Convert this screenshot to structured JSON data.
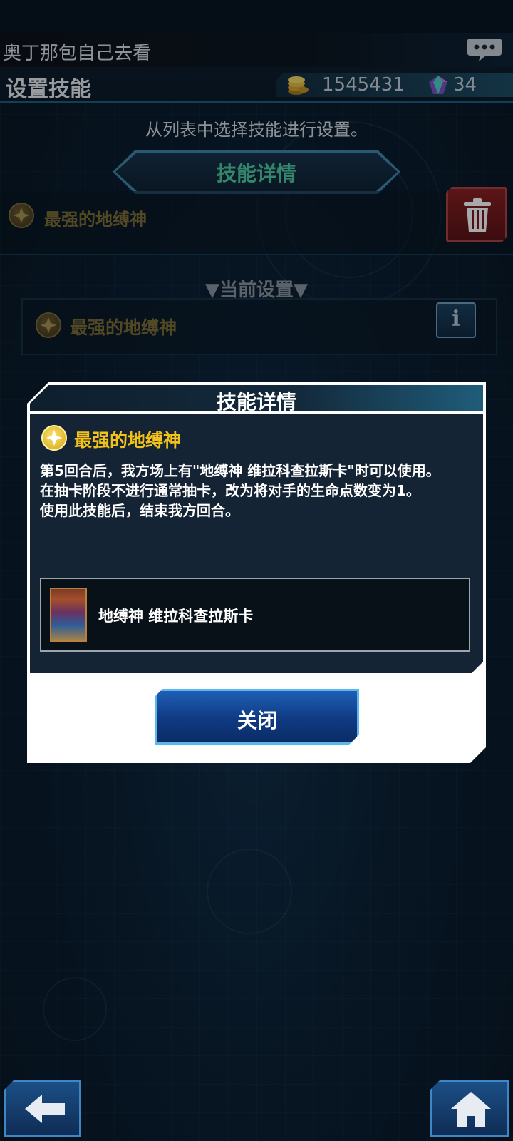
{
  "user": {
    "name": "奥丁那包自己去看"
  },
  "header": {
    "title": "设置技能"
  },
  "currency": {
    "gold": "1545431",
    "gems": "34"
  },
  "instruction": "从列表中选择技能进行设置。",
  "banner": {
    "label": "技能详情"
  },
  "selected_skill": {
    "name": "最强的地缚神"
  },
  "current": {
    "label": "▼当前设置▼",
    "skill_name": "最强的地缚神",
    "info_label": "i"
  },
  "modal": {
    "title": "技能详情",
    "skill_name": "最强的地缚神",
    "description": [
      "第5回合后，我方场上有\"地缚神 维拉科查拉斯卡\"时可以使用。",
      "在抽卡阶段不进行通常抽卡，改为将对手的生命点数变为1。",
      "使用此技能后，结束我方回合。"
    ],
    "card_name": "地缚神 维拉科查拉斯卡",
    "close_label": "关闭"
  },
  "icons": {
    "chat": "chat-bubble-icon",
    "gold": "gold-coins-icon",
    "gem": "gem-icon",
    "skill": "star-icon",
    "delete": "trash-icon",
    "back": "back-arrow-icon",
    "home": "home-icon"
  },
  "colors": {
    "accent_gold": "#f2c21a",
    "banner_text": "#4ec99f",
    "button_blue": "#1f5fb6",
    "delete_red": "#8a1d1d"
  }
}
